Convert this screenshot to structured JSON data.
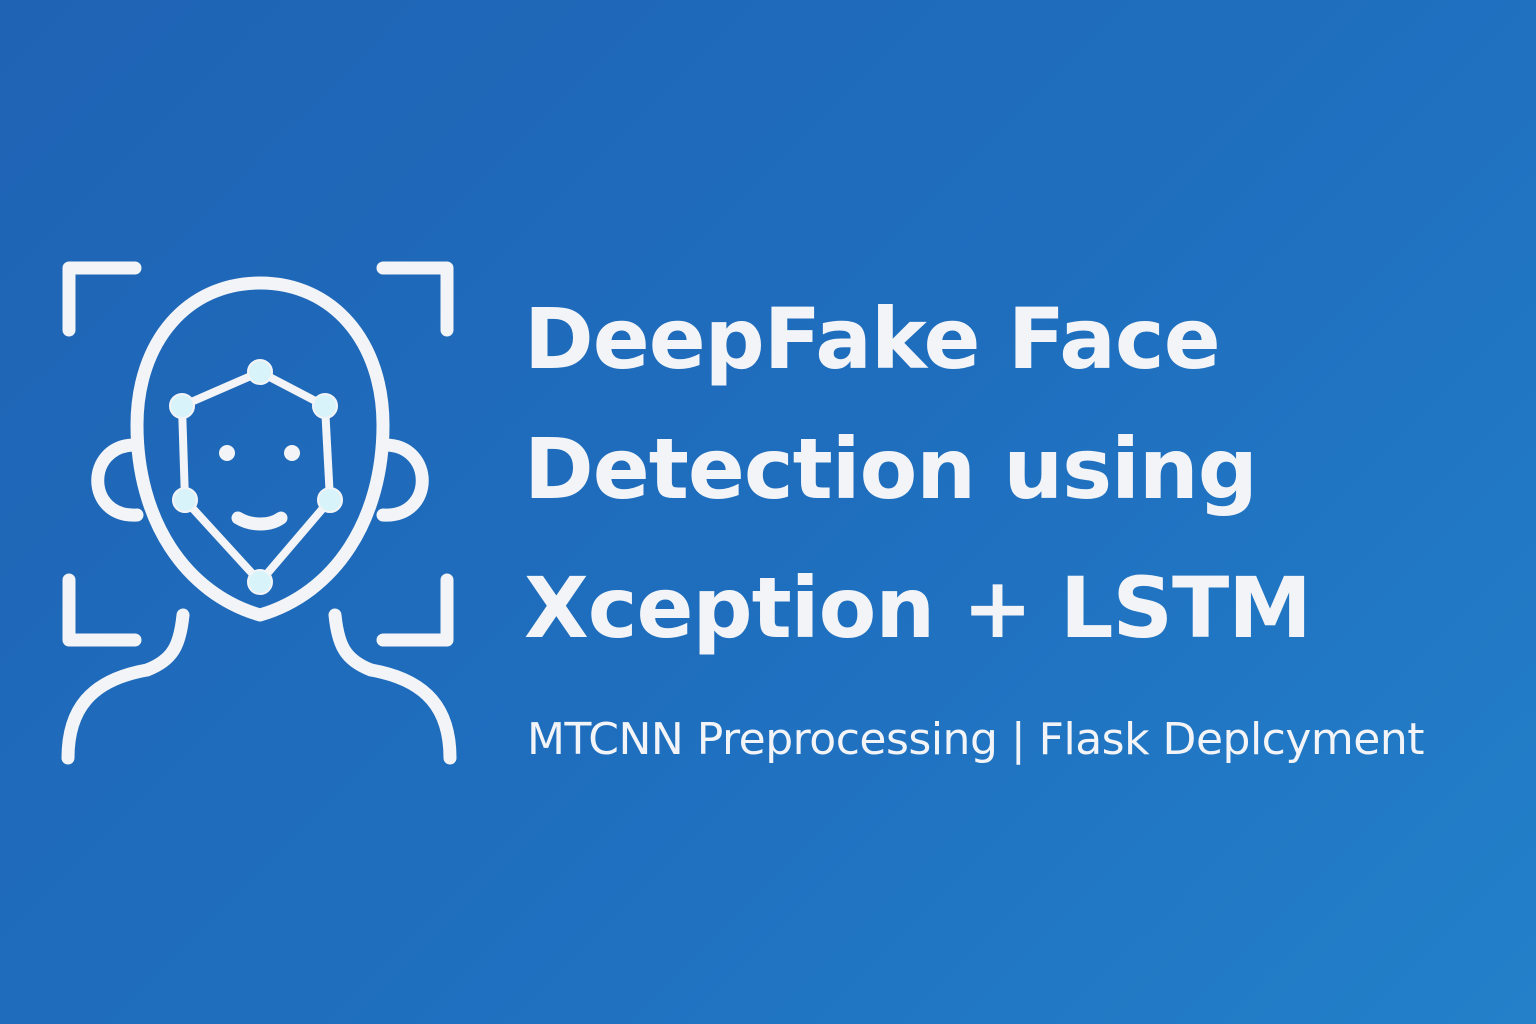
{
  "colors": {
    "background": "#1f6ab9",
    "foreground": "#f2f4f7",
    "landmark": "#d9f3fb"
  },
  "graphic": {
    "icon": "face-detection-icon"
  },
  "title": {
    "line1": "DeepFake Face",
    "line2": "Detection using",
    "line3": "Xception + LSTM"
  },
  "subtitle": "MTCNN Preprocessing | Flask Deplcyment"
}
